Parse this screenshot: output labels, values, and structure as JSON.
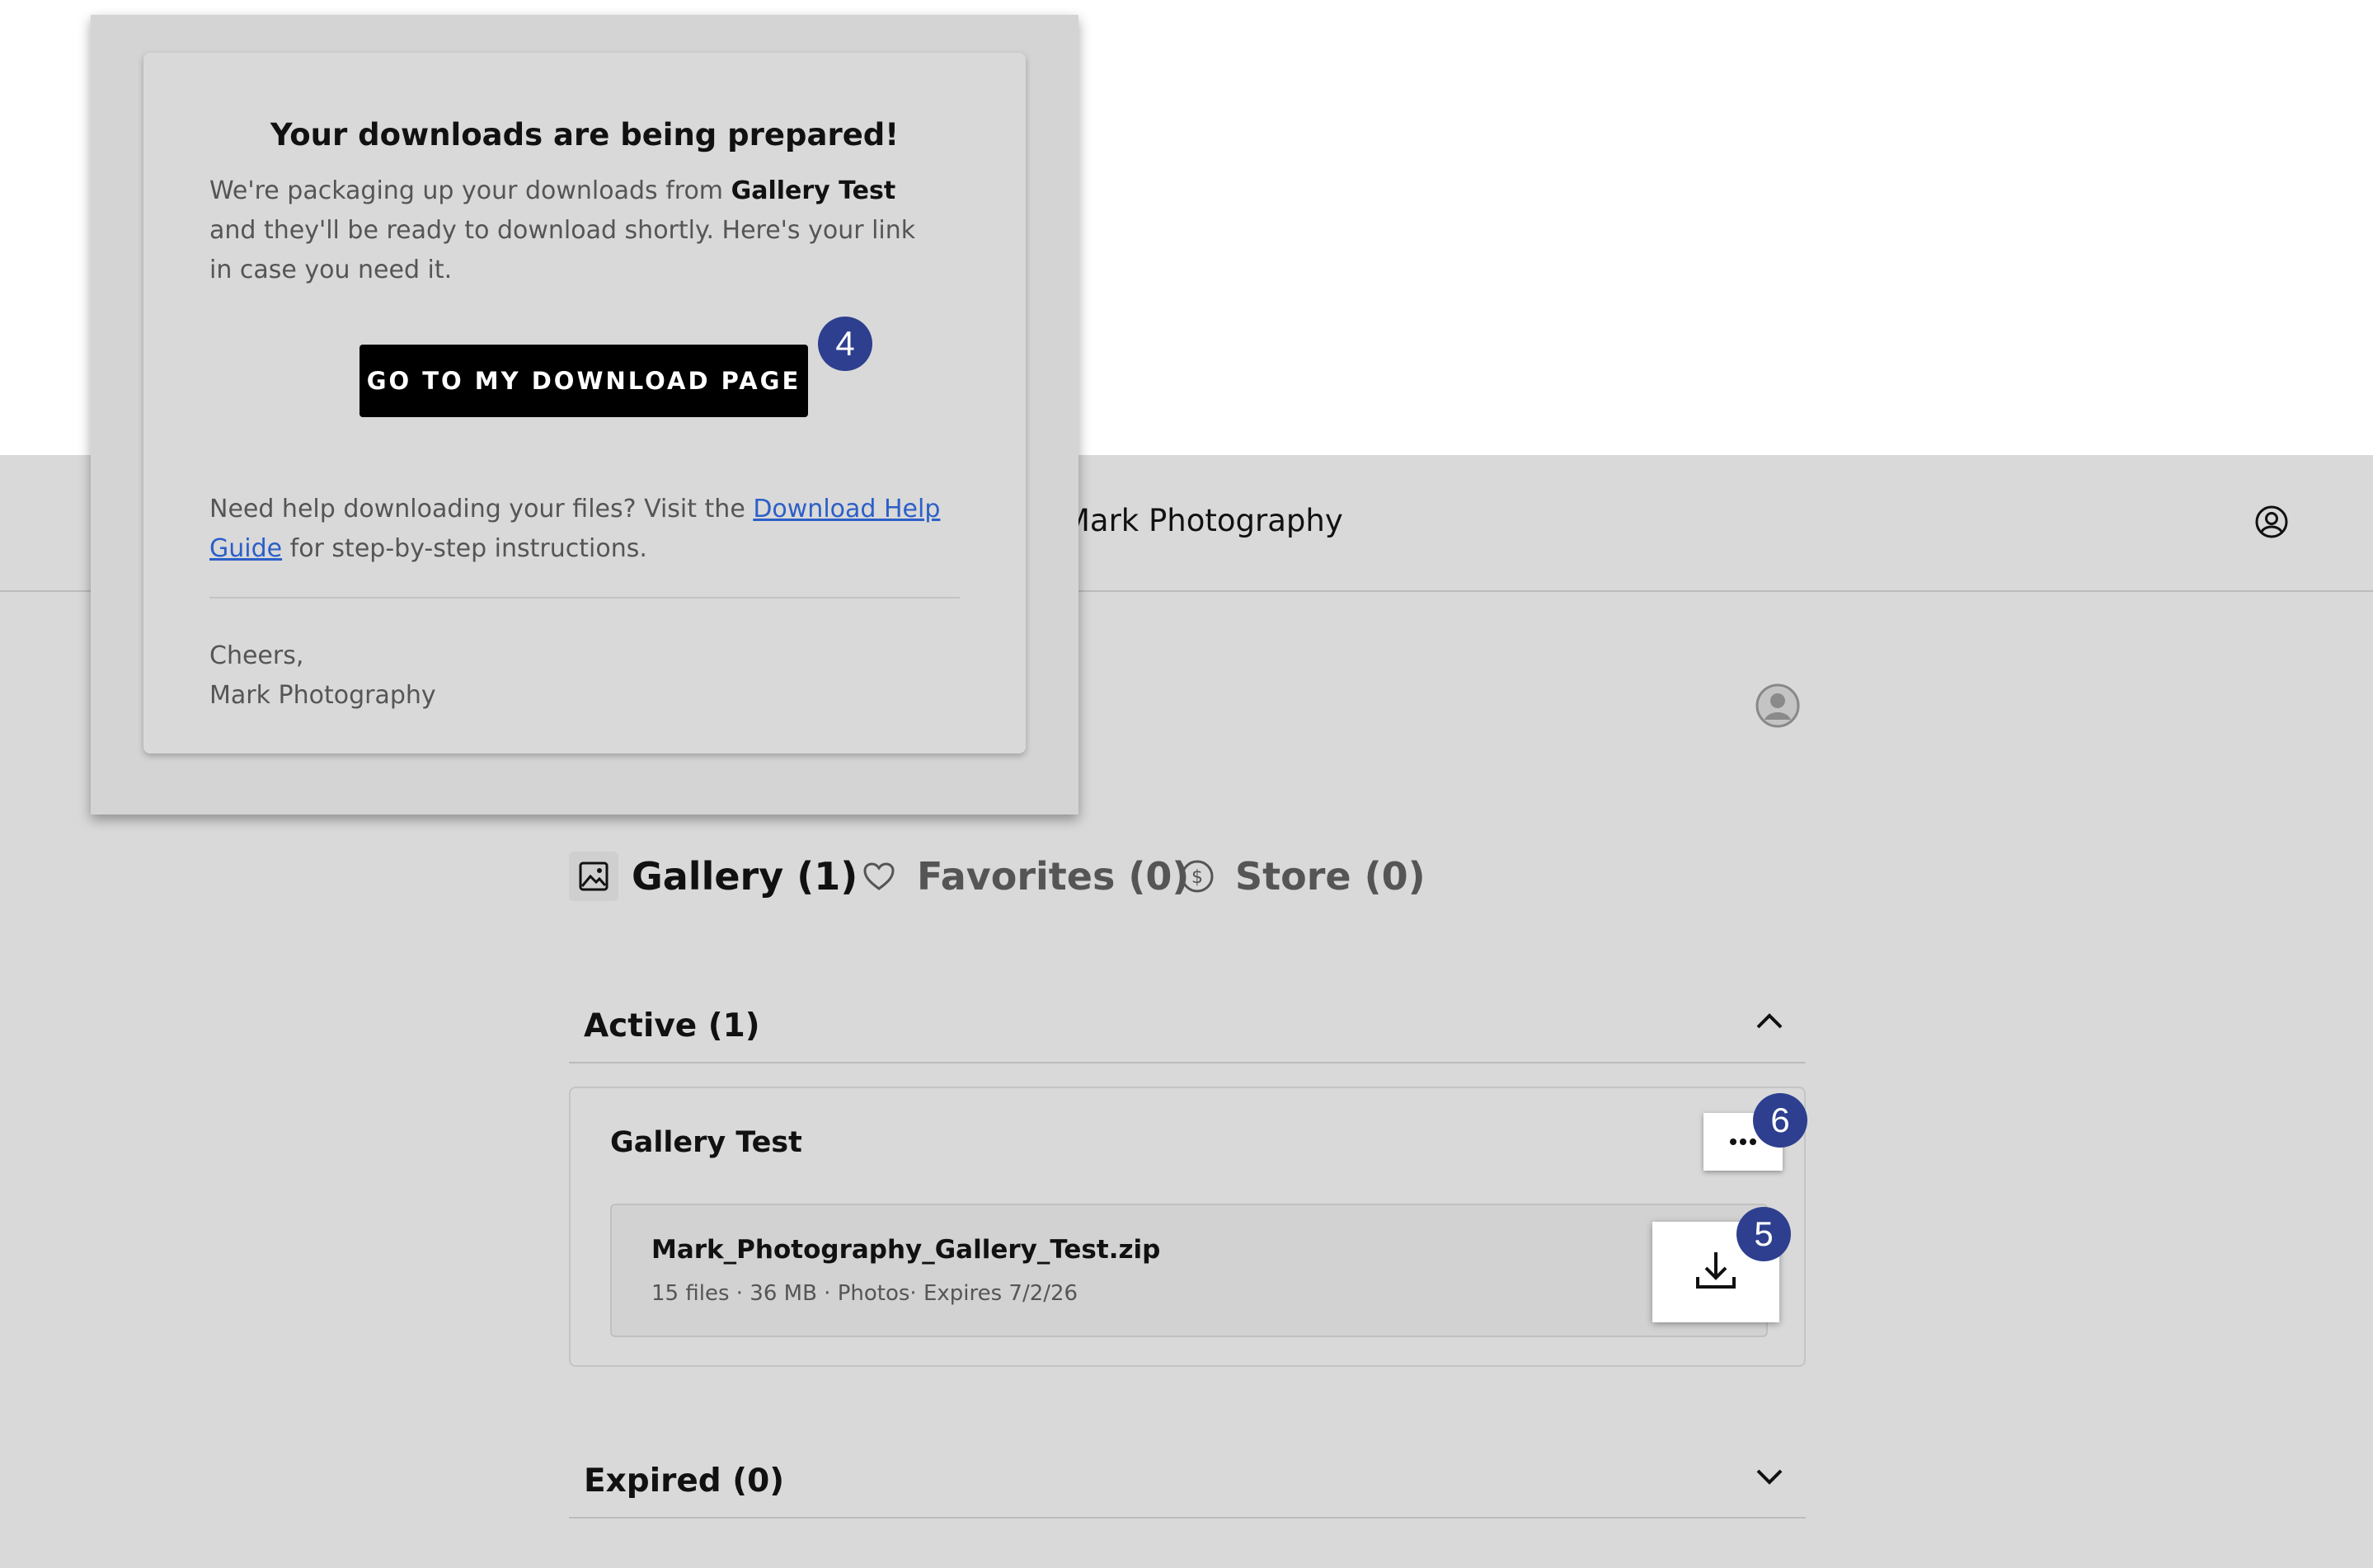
{
  "header": {
    "brand": "Mark Photography"
  },
  "tabs": [
    {
      "label": "Gallery (1)"
    },
    {
      "label": "Favorites (0)"
    },
    {
      "label": "Store (0)"
    }
  ],
  "sections": {
    "active": {
      "title": "Active (1)"
    },
    "expired": {
      "title": "Expired (0)"
    }
  },
  "gallery_card": {
    "title": "Gallery Test",
    "file": {
      "name": "Mark_Photography_Gallery_Test.zip",
      "meta": "15 files · 36 MB · Photos· Expires 7/2/26"
    }
  },
  "badges": {
    "download_page": "4",
    "download": "5",
    "more": "6"
  },
  "modal": {
    "title": "Your downloads are being prepared!",
    "body_pre": "We're packaging up your downloads from ",
    "body_gallery": "Gallery Test",
    "body_post": " and they'll be ready to download shortly. Here's your link in case you need it.",
    "button_label": "GO TO MY DOWNLOAD PAGE",
    "help_pre": "Need help downloading your files? Visit the ",
    "help_link": "Download Help Guide",
    "help_post": " for step-by-step instructions.",
    "sign_line1": "Cheers,",
    "sign_line2": "Mark Photography"
  },
  "icons": {
    "gallery_tab": "image-icon",
    "favorites_tab": "heart-icon",
    "store_tab": "dollar-circle-icon",
    "account": "user-circle-icon",
    "more": "ellipsis-icon",
    "download": "download-icon",
    "chevron_up": "chevron-up-icon",
    "chevron_down": "chevron-down-icon"
  },
  "colors": {
    "badge": "#2e3f8f",
    "link": "#2c5fc7",
    "primary_button": "#000000"
  }
}
